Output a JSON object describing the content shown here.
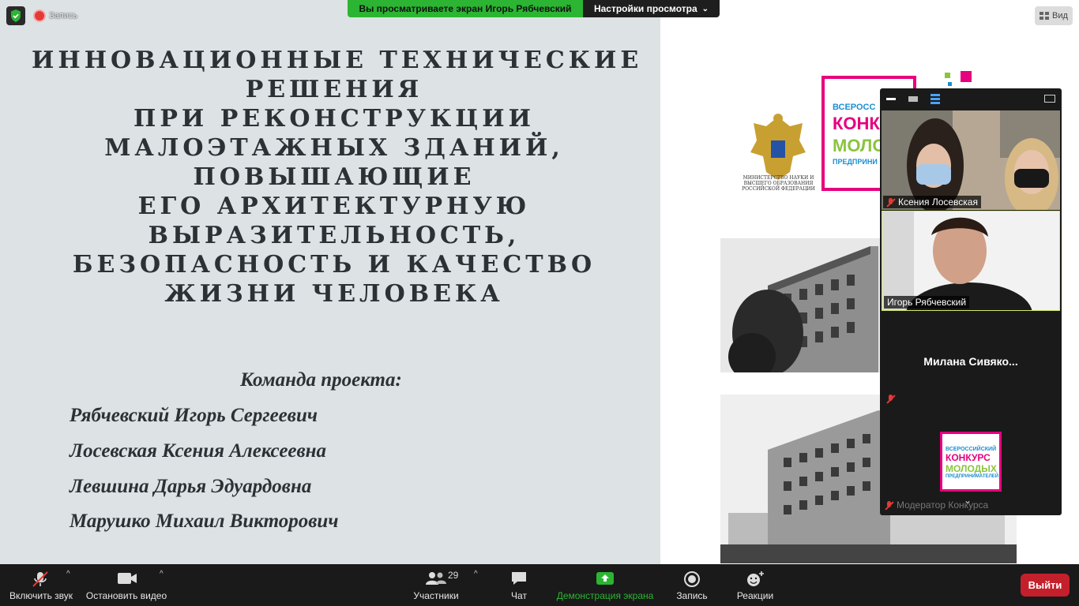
{
  "recording": {
    "label": "Запись"
  },
  "viewing_banner": {
    "text": "Вы просматриваете экран Игорь Рябчевский",
    "settings_label": "Настройки просмотра"
  },
  "view_button": {
    "label": "Вид"
  },
  "slide": {
    "title_lines": [
      "ИННОВАЦИОННЫЕ ТЕХНИЧЕСКИЕ",
      "РЕШЕНИЯ",
      "ПРИ РЕКОНСТРУКЦИИ",
      "МАЛОЭТАЖНЫХ ЗДАНИЙ,",
      "ПОВЫШАЮЩИЕ",
      "ЕГО АРХИТЕКТУРНУЮ",
      "ВЫРАЗИТЕЛЬНОСТЬ,",
      "БЕЗОПАСНОСТЬ И КАЧЕСТВО",
      "ЖИЗНИ ЧЕЛОВЕКА"
    ],
    "team_heading": "Команда проекта:",
    "team_members": [
      "Рябчевский Игорь Сергеевич",
      "Лосевская Ксения Алексеевна",
      "Левшина Дарья Эдуардовна",
      "Марушко Михаил Викторович"
    ],
    "ministry_text": "МИНИСТЕРСТВО НАУКИ И ВЫСШЕГО ОБРАЗОВАНИЯ РОССИЙСКОЙ ФЕДЕРАЦИИ",
    "contest_logo": {
      "line1": "ВСЕРОСС",
      "line2": "КОНК",
      "line3": "МОЛОД",
      "line4": "ПРЕДПРИНИ"
    }
  },
  "participants": [
    {
      "name": "Ксения Лосевская",
      "muted": true
    },
    {
      "name": "Игорь Рябчевский",
      "muted": false
    },
    {
      "name": "Милана  Сивяко...",
      "muted": true
    },
    {
      "name": "Модератор Конкурса",
      "muted": true
    }
  ],
  "small_logo": {
    "line1": "ВСЕРОССИЙСКИЙ",
    "line2": "КОНКУРС",
    "line3": "МОЛОДЫХ",
    "line4": "ПРЕДПРИНИМАТЕЛЕЙ"
  },
  "toolbar": {
    "unmute": "Включить звук",
    "stop_video": "Остановить видео",
    "participants": "Участники",
    "participants_count": "29",
    "chat": "Чат",
    "share": "Демонстрация экрана",
    "record": "Запись",
    "reactions": "Реакции",
    "leave": "Выйти"
  },
  "colors": {
    "accent_green": "#2bb532",
    "leave_red": "#c4202c",
    "muted_red": "#e53935",
    "brand_pink": "#e6007e"
  }
}
